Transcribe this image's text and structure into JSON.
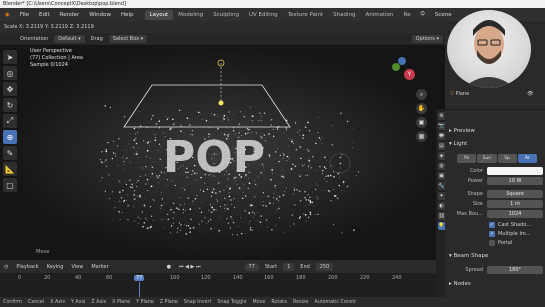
{
  "title_bar": "Blender* [C:\\Users\\ConceptX\\Desktop\\pop.blend]",
  "menu": [
    "File",
    "Edit",
    "Render",
    "Window",
    "Help"
  ],
  "workspaces": [
    "Layout",
    "Modeling",
    "Sculpting",
    "UV Editing",
    "Texture Paint",
    "Shading",
    "Animation",
    "Re"
  ],
  "active_workspace": "Layout",
  "scene_label": "Scene",
  "header": {
    "scale": "Scale X: 3.2119   Y: 3.2119   Z: 3.2119",
    "orientation_label": "Orientation",
    "orientation_value": "Default",
    "drag_label": "Drag",
    "drag_value": "Select Box",
    "options": "Options"
  },
  "viewport": {
    "perspective": "User Perspective",
    "collection": "(77) Collection | Area",
    "sample": "Sample 0/1024",
    "text3d": "POP",
    "move_label": "Move"
  },
  "outliner": {
    "plane_label": "Plane"
  },
  "properties": {
    "preview": "Preview",
    "light": "Light",
    "light_types": [
      "Po",
      "Sun",
      "Sp",
      "Ar"
    ],
    "active_light_type": "Ar",
    "color_label": "Color",
    "power_label": "Power",
    "power_value": "10 W",
    "shape_label": "Shape",
    "shape_value": "Square",
    "size_label": "Size",
    "size_value": "1 m",
    "max_bounces_label": "Max Bou...",
    "max_bounces_value": "1024",
    "cast_shadow": "Cast Shado...",
    "multiple_importance": "Multiple Im...",
    "portal": "Portal",
    "beam_shape": "Beam Shape",
    "spread_label": "Spread",
    "spread_value": "180°",
    "nodes": "Nodes"
  },
  "timeline": {
    "playback": "Playback",
    "keying": "Keying",
    "view": "View",
    "marker": "Marker",
    "current_frame": "77",
    "start_label": "Start",
    "start_value": "1",
    "end_label": "End",
    "end_value": "250",
    "ticks": [
      "0",
      "20",
      "40",
      "60",
      "77",
      "100",
      "120",
      "140",
      "160",
      "180",
      "200",
      "220",
      "240"
    ]
  },
  "status": [
    "Confirm",
    "Cancel",
    "X Axis",
    "Y Axis",
    "Z Axis",
    "X Plane",
    "Y Plane",
    "Z Plane",
    "Snap Invert",
    "Snap Toggle",
    "Move",
    "Rotate",
    "Resize",
    "Automatic Constr"
  ],
  "colors": {
    "accent": "#4772b3",
    "frame_marker": "#5680c2"
  }
}
